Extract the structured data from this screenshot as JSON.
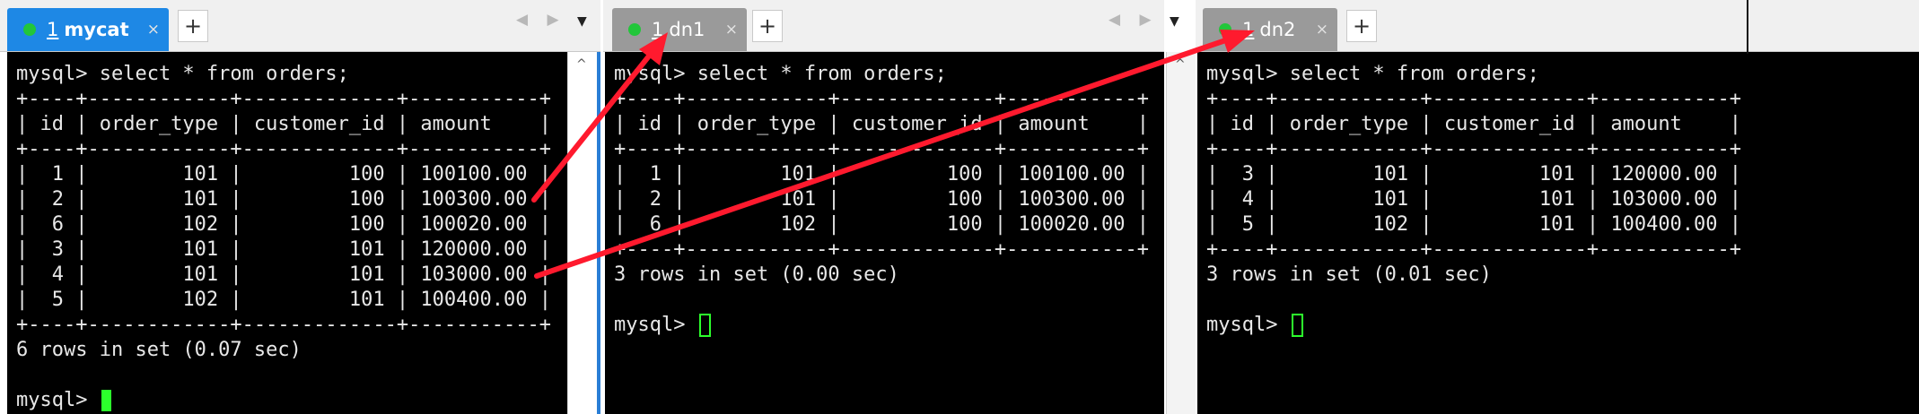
{
  "panes": [
    {
      "tab": {
        "number": "1",
        "name": "mycat",
        "close": "×",
        "add": "+"
      },
      "nav": {
        "arrows": "◀ ▶",
        "dropdown": "▼"
      },
      "scroll_up": "^",
      "terminal": {
        "lines": [
          "mysql> select * from orders;",
          "+----+------------+-------------+-----------+",
          "| id | order_type | customer_id | amount    |",
          "+----+------------+-------------+-----------+",
          "|  1 |        101 |         100 | 100100.00 |",
          "|  2 |        101 |         100 | 100300.00 |",
          "|  6 |        102 |         100 | 100020.00 |",
          "|  3 |        101 |         101 | 120000.00 |",
          "|  4 |        101 |         101 | 103000.00 |",
          "|  5 |        102 |         101 | 100400.00 |",
          "+----+------------+-------------+-----------+",
          "6 rows in set (0.07 sec)",
          ""
        ],
        "prompt": "mysql> "
      }
    },
    {
      "tab": {
        "number": "1",
        "name": "dn1",
        "close": "×",
        "add": "+"
      },
      "nav": {
        "arrows": "◀ ▶",
        "dropdown": "▼"
      },
      "scroll_up": "^",
      "terminal": {
        "lines": [
          "mysql> select * from orders;",
          "+----+------------+-------------+-----------+",
          "| id | order_type | customer_id | amount    |",
          "+----+------------+-------------+-----------+",
          "|  1 |        101 |         100 | 100100.00 |",
          "|  2 |        101 |         100 | 100300.00 |",
          "|  6 |        102 |         100 | 100020.00 |",
          "+----+------------+-------------+-----------+",
          "3 rows in set (0.00 sec)",
          ""
        ],
        "prompt": "mysql> "
      }
    },
    {
      "tab": {
        "number": "1",
        "name": "dn2",
        "close": "×",
        "add": "+"
      },
      "terminal": {
        "lines": [
          "mysql> select * from orders;",
          "+----+------------+-------------+-----------+",
          "| id | order_type | customer_id | amount    |",
          "+----+------------+-------------+-----------+",
          "|  3 |        101 |         101 | 120000.00 |",
          "|  4 |        101 |         101 | 103000.00 |",
          "|  5 |        102 |         101 | 100400.00 |",
          "+----+------------+-------------+-----------+",
          "3 rows in set (0.01 sec)",
          ""
        ],
        "prompt": "mysql> "
      }
    }
  ],
  "colors": {
    "active_tab": "#1e88e5",
    "inactive_tab": "#9a9a9a",
    "status_dot": "#22c63a",
    "cursor": "#2cff2c",
    "annotation_arrow": "#ff1a2e"
  }
}
